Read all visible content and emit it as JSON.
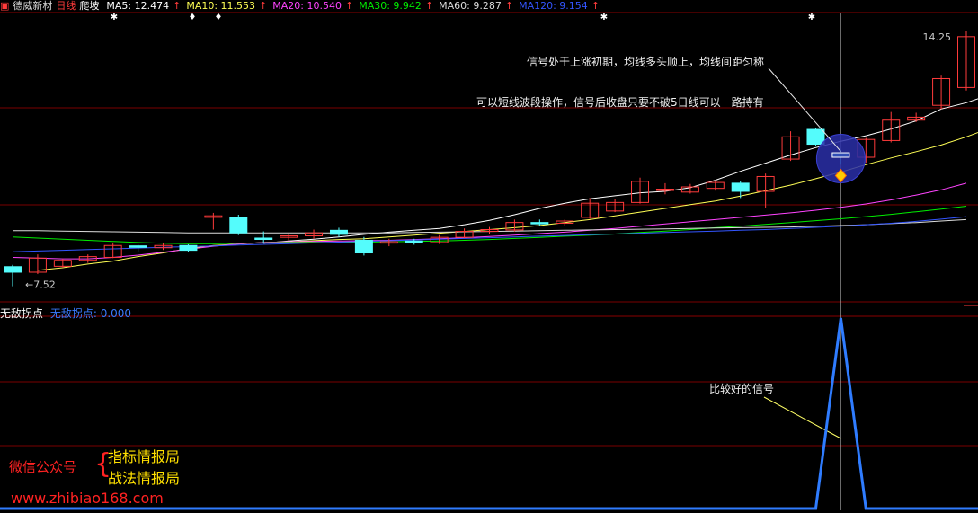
{
  "header": {
    "icon": "stock-icon",
    "name": "德威新材",
    "period": "日线",
    "indicator": "爬坡",
    "ma": [
      {
        "label": "MA5: 12.474",
        "arrow": "↑",
        "color": "#ffffff"
      },
      {
        "label": "MA10: 11.553",
        "arrow": "↑",
        "color": "#ffff55"
      },
      {
        "label": "MA20: 10.540",
        "arrow": "↑",
        "color": "#ff44ff"
      },
      {
        "label": "MA30: 9.942",
        "arrow": "↑",
        "color": "#00ee00"
      },
      {
        "label": "MA60: 9.287",
        "arrow": "↑",
        "color": "#dddddd"
      },
      {
        "label": "MA120: 9.154",
        "arrow": "↑",
        "color": "#3355ff"
      }
    ]
  },
  "sub_panel": {
    "name": "无敌拐点",
    "value_label": "无敌拐点: 0.000"
  },
  "annotations": {
    "line1": "信号处于上涨初期，均线多头顺上，均线间距匀称",
    "line2": "可以短线波段操作，信号后收盘只要不破5日线可以一路持有",
    "sub": "比较好的信号"
  },
  "promo": {
    "left": "微信公众号",
    "right1": "指标情报局",
    "right2": "战法情报局",
    "url": "www.zhibiao168.com"
  },
  "colors": {
    "up": "#ff3b3b",
    "down": "#54fcfc",
    "grid": "#7a0000",
    "signal": "#2f7cff"
  },
  "chart_data": {
    "type": "candlestick",
    "y_axis": {
      "max_label": "14.25",
      "min_label": "7.52",
      "ylim": [
        7.1,
        14.9
      ]
    },
    "candles": [
      {
        "o": 8.05,
        "c": 7.9,
        "h": 8.1,
        "l": 7.52
      },
      {
        "o": 7.9,
        "c": 8.28,
        "h": 8.38,
        "l": 7.85
      },
      {
        "o": 8.06,
        "c": 8.22,
        "h": 8.26,
        "l": 8.02
      },
      {
        "o": 8.22,
        "c": 8.32,
        "h": 8.38,
        "l": 8.15
      },
      {
        "o": 8.3,
        "c": 8.62,
        "h": 8.7,
        "l": 8.28
      },
      {
        "o": 8.61,
        "c": 8.57,
        "h": 8.64,
        "l": 8.46
      },
      {
        "o": 8.56,
        "c": 8.62,
        "h": 8.7,
        "l": 8.5
      },
      {
        "o": 8.62,
        "c": 8.49,
        "h": 8.65,
        "l": 8.45
      },
      {
        "o": 9.38,
        "c": 9.42,
        "h": 9.5,
        "l": 9.05
      },
      {
        "o": 9.38,
        "c": 8.96,
        "h": 9.45,
        "l": 8.9
      },
      {
        "o": 8.82,
        "c": 8.8,
        "h": 9.0,
        "l": 8.7
      },
      {
        "o": 8.84,
        "c": 8.88,
        "h": 8.95,
        "l": 8.75
      },
      {
        "o": 8.88,
        "c": 8.96,
        "h": 9.05,
        "l": 8.8
      },
      {
        "o": 9.03,
        "c": 8.92,
        "h": 9.1,
        "l": 8.85
      },
      {
        "o": 8.76,
        "c": 8.42,
        "h": 8.85,
        "l": 8.35
      },
      {
        "o": 8.7,
        "c": 8.72,
        "h": 8.8,
        "l": 8.6
      },
      {
        "o": 8.74,
        "c": 8.7,
        "h": 8.8,
        "l": 8.64
      },
      {
        "o": 8.7,
        "c": 8.84,
        "h": 8.9,
        "l": 8.66
      },
      {
        "o": 8.84,
        "c": 9.0,
        "h": 9.08,
        "l": 8.82
      },
      {
        "o": 9.0,
        "c": 9.05,
        "h": 9.12,
        "l": 8.94
      },
      {
        "o": 9.04,
        "c": 9.24,
        "h": 9.32,
        "l": 9.0
      },
      {
        "o": 9.24,
        "c": 9.22,
        "h": 9.32,
        "l": 9.16
      },
      {
        "o": 9.22,
        "c": 9.28,
        "h": 9.32,
        "l": 9.15
      },
      {
        "o": 9.38,
        "c": 9.76,
        "h": 9.9,
        "l": 9.34
      },
      {
        "o": 9.55,
        "c": 9.78,
        "h": 9.88,
        "l": 9.52
      },
      {
        "o": 9.78,
        "c": 10.35,
        "h": 10.45,
        "l": 9.75
      },
      {
        "o": 10.12,
        "c": 10.14,
        "h": 10.3,
        "l": 10.0
      },
      {
        "o": 10.06,
        "c": 10.2,
        "h": 10.28,
        "l": 10.02
      },
      {
        "o": 10.16,
        "c": 10.32,
        "h": 10.38,
        "l": 10.1
      },
      {
        "o": 10.3,
        "c": 10.08,
        "h": 10.35,
        "l": 9.9
      },
      {
        "o": 10.08,
        "c": 10.48,
        "h": 10.56,
        "l": 9.62
      },
      {
        "o": 10.95,
        "c": 11.55,
        "h": 11.7,
        "l": 10.9
      },
      {
        "o": 11.75,
        "c": 11.35,
        "h": 11.8,
        "l": 11.3
      },
      {
        "o": 11.12,
        "c": 11.0,
        "h": 11.2,
        "l": 10.8
      },
      {
        "o": 11.0,
        "c": 11.48,
        "h": 11.52,
        "l": 10.85
      },
      {
        "o": 11.45,
        "c": 12.0,
        "h": 12.22,
        "l": 11.4
      },
      {
        "o": 12.0,
        "c": 12.08,
        "h": 12.2,
        "l": 11.95
      },
      {
        "o": 12.4,
        "c": 13.12,
        "h": 13.2,
        "l": 12.3
      },
      {
        "o": 12.88,
        "c": 14.25,
        "h": 14.4,
        "l": 12.8
      }
    ],
    "ma_series": [
      {
        "color": "#ffffff",
        "from": 10,
        "values": [
          8.68,
          8.74,
          8.79,
          8.85,
          8.92,
          8.98,
          9.03,
          9.08,
          9.18,
          9.3,
          9.45,
          9.62,
          9.76,
          9.88,
          9.96,
          10.04,
          10.08,
          10.18,
          10.38,
          10.62,
          10.84,
          11.06,
          11.26,
          11.43,
          11.58,
          11.76,
          11.98,
          12.3,
          12.47,
          12.7,
          13.0
        ]
      },
      {
        "color": "#ffff55",
        "from": 1,
        "values": [
          7.95,
          8.02,
          8.12,
          8.2,
          8.32,
          8.42,
          8.54,
          8.62,
          8.66,
          8.7,
          8.72,
          8.75,
          8.78,
          8.8,
          8.85,
          8.9,
          8.95,
          9.0,
          9.05,
          9.1,
          9.16,
          9.24,
          9.32,
          9.42,
          9.52,
          9.62,
          9.72,
          9.82,
          9.95,
          10.1,
          10.25,
          10.42,
          10.6,
          10.8,
          10.98,
          11.15,
          11.33,
          11.55,
          11.8
        ]
      },
      {
        "color": "#ff44ff",
        "from": 0,
        "values": [
          8.3,
          8.28,
          8.26,
          8.26,
          8.3,
          8.36,
          8.44,
          8.52,
          8.6,
          8.66,
          8.7,
          8.72,
          8.73,
          8.74,
          8.75,
          8.76,
          8.78,
          8.8,
          8.83,
          8.86,
          8.9,
          8.94,
          8.98,
          9.03,
          9.08,
          9.14,
          9.2,
          9.26,
          9.32,
          9.38,
          9.44,
          9.5,
          9.57,
          9.65,
          9.74,
          9.85,
          9.98,
          10.12,
          10.3
        ]
      },
      {
        "color": "#00ee00",
        "from": 0,
        "values": [
          8.85,
          8.82,
          8.79,
          8.76,
          8.73,
          8.7,
          8.68,
          8.67,
          8.67,
          8.68,
          8.69,
          8.7,
          8.7,
          8.7,
          8.71,
          8.72,
          8.73,
          8.74,
          8.76,
          8.78,
          8.81,
          8.84,
          8.87,
          8.9,
          8.93,
          8.97,
          9.01,
          9.05,
          9.1,
          9.14,
          9.19,
          9.24,
          9.29,
          9.34,
          9.4,
          9.46,
          9.53,
          9.6,
          9.68
        ]
      },
      {
        "color": "#dddddd",
        "from": 0,
        "values": [
          9.02,
          9.02,
          9.01,
          9.0,
          8.99,
          8.98,
          8.97,
          8.96,
          8.96,
          8.96,
          8.96,
          8.96,
          8.96,
          8.96,
          8.96,
          8.96,
          8.97,
          8.98,
          8.99,
          9.0,
          9.01,
          9.02,
          9.03,
          9.04,
          9.05,
          9.06,
          9.07,
          9.08,
          9.09,
          9.1,
          9.11,
          9.12,
          9.14,
          9.16,
          9.18,
          9.21,
          9.24,
          9.28,
          9.32
        ]
      },
      {
        "color": "#3355ff",
        "from": 0,
        "values": [
          8.45,
          8.47,
          8.49,
          8.51,
          8.53,
          8.55,
          8.57,
          8.59,
          8.61,
          8.63,
          8.65,
          8.67,
          8.69,
          8.71,
          8.73,
          8.75,
          8.77,
          8.79,
          8.81,
          8.83,
          8.85,
          8.87,
          8.89,
          8.91,
          8.93,
          8.95,
          8.97,
          8.99,
          9.01,
          9.03,
          9.05,
          9.08,
          9.11,
          9.14,
          9.18,
          9.22,
          9.27,
          9.33,
          9.4
        ]
      }
    ],
    "signal": {
      "index": 33,
      "value": 1.0,
      "baseline": 0.0
    }
  }
}
